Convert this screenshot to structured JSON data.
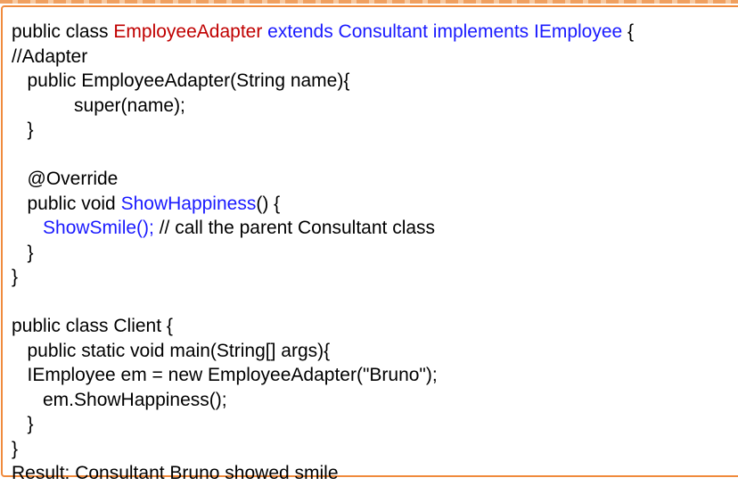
{
  "colors": {
    "border": "#f08a3c",
    "text": "#000000",
    "class_name": "#c00000",
    "keyword_highlight": "#1a1aff"
  },
  "code": {
    "lines": [
      [
        {
          "text": "public class ",
          "style": "black"
        },
        {
          "text": "EmployeeAdapter",
          "style": "red"
        },
        {
          "text": " extends Consultant implements IEmployee",
          "style": "blue"
        },
        {
          "text": " {",
          "style": "black"
        }
      ],
      [
        {
          "text": "//Adapter",
          "style": "black"
        }
      ],
      [
        {
          "text": "   public EmployeeAdapter(String name){",
          "style": "black"
        }
      ],
      [
        {
          "text": "            super(name);",
          "style": "black"
        }
      ],
      [
        {
          "text": "   }",
          "style": "black"
        }
      ],
      [
        {
          "text": "",
          "style": "black"
        }
      ],
      [
        {
          "text": "   @Override",
          "style": "black"
        }
      ],
      [
        {
          "text": "   public void ",
          "style": "black"
        },
        {
          "text": "ShowHappiness",
          "style": "blue"
        },
        {
          "text": "() {",
          "style": "black"
        }
      ],
      [
        {
          "text": "      ",
          "style": "black"
        },
        {
          "text": "ShowSmile();",
          "style": "blue"
        },
        {
          "text": " // call the parent Consultant class",
          "style": "black"
        }
      ],
      [
        {
          "text": "   }",
          "style": "black"
        }
      ],
      [
        {
          "text": "}",
          "style": "black"
        }
      ],
      [
        {
          "text": "",
          "style": "black"
        }
      ],
      [
        {
          "text": "public class Client {",
          "style": "black"
        }
      ],
      [
        {
          "text": "   public static void main(String[] args){",
          "style": "black"
        }
      ],
      [
        {
          "text": "   IEmployee em = new EmployeeAdapter(\"Bruno\");",
          "style": "black"
        }
      ],
      [
        {
          "text": "      em.ShowHappiness();",
          "style": "black"
        }
      ],
      [
        {
          "text": "   }",
          "style": "black"
        }
      ],
      [
        {
          "text": "}",
          "style": "black"
        }
      ],
      [
        {
          "text": "Result: Consultant Bruno showed smile",
          "style": "black"
        }
      ]
    ]
  }
}
